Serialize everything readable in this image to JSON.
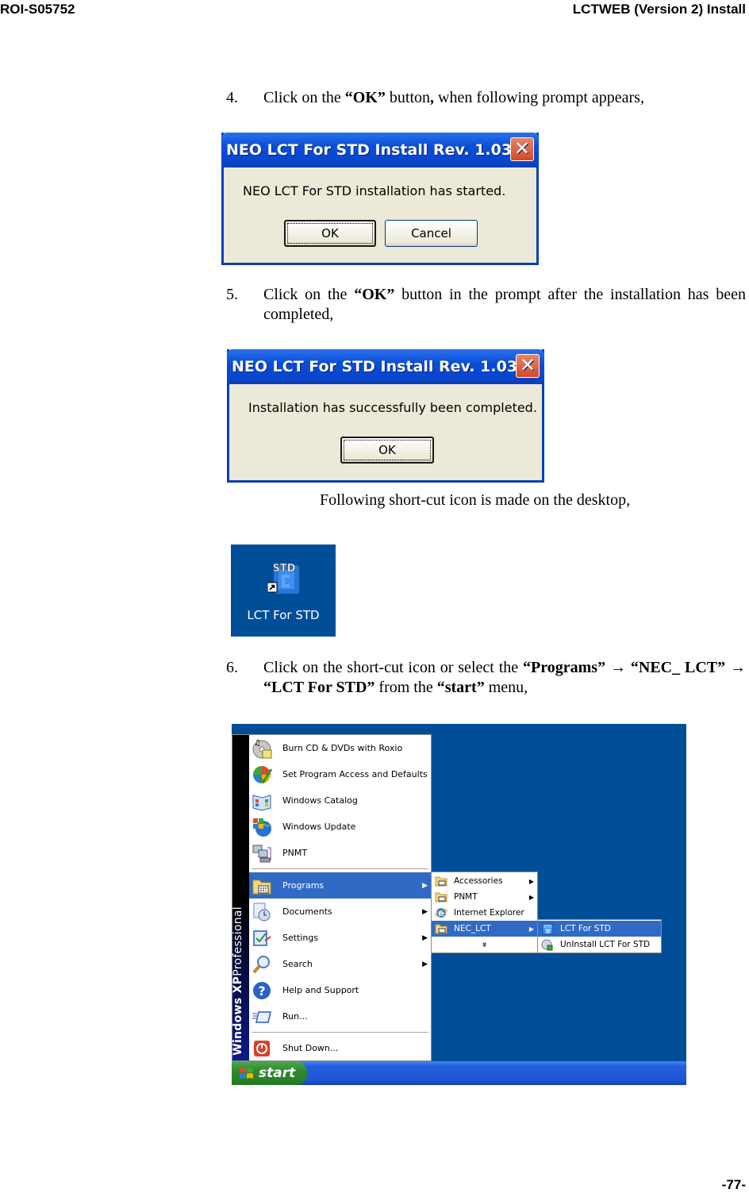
{
  "header": {
    "doc_id": "ROI-S05752",
    "title": "LCTWEB (Version 2) Install"
  },
  "footer": {
    "page": "-77-"
  },
  "steps": [
    {
      "num": "4.",
      "parts": [
        "Click on the ",
        "“OK”",
        " button",
        ",",
        " when following prompt appears,"
      ]
    },
    {
      "num": "5.",
      "parts": [
        "Click on the ",
        "“OK”",
        " button in the prompt after the installation has been completed,"
      ]
    },
    {
      "num": "6.",
      "parts": [
        "Click on the short-cut icon or select the ",
        "“Programs”",
        " → ",
        "“NEC_ LCT”",
        " → ",
        "“LCT For STD”",
        " from the ",
        "“start”",
        " menu,"
      ]
    }
  ],
  "caption_shortcut": "Following short-cut icon is made on the desktop,",
  "dialog1": {
    "title": "NEO LCT For STD Install  Rev. 1.03",
    "message": "NEO LCT For STD installation has started.",
    "ok": "OK",
    "cancel": "Cancel",
    "close_glyph": "✕"
  },
  "dialog2": {
    "title": "NEO LCT For STD Install  Rev. 1.03",
    "message": "Installation has successfully been completed.",
    "ok": "OK",
    "close_glyph": "✕"
  },
  "desktop_icon": {
    "label": "LCT For STD",
    "badge": "STD"
  },
  "start_menu": {
    "band_bold": "Windows XP",
    "band_light": "Professional",
    "top_items": [
      {
        "label": "Burn CD & DVDs with Roxio",
        "icon": "cd-icon"
      },
      {
        "label": "Set Program Access and Defaults",
        "icon": "program-access-icon"
      },
      {
        "label": "Windows Catalog",
        "icon": "catalog-icon"
      },
      {
        "label": "Windows Update",
        "icon": "windows-update-icon"
      },
      {
        "label": "PNMT",
        "icon": "network-computer-icon"
      }
    ],
    "main_items": [
      {
        "label": "Programs",
        "icon": "programs-folder-icon",
        "submenu": true,
        "selected": true
      },
      {
        "label": "Documents",
        "icon": "documents-icon",
        "submenu": true
      },
      {
        "label": "Settings",
        "icon": "settings-icon",
        "submenu": true
      },
      {
        "label": "Search",
        "icon": "search-icon",
        "submenu": true
      },
      {
        "label": "Help and Support",
        "icon": "help-icon"
      },
      {
        "label": "Run...",
        "icon": "run-icon"
      }
    ],
    "shutdown": "Shut Down...",
    "start_label": "start",
    "programs_submenu": [
      {
        "label": "Accessories",
        "submenu": true
      },
      {
        "label": "PNMT",
        "submenu": true
      },
      {
        "label": "Internet Explorer"
      },
      {
        "label": "NEC_LCT",
        "submenu": true,
        "selected": true
      },
      {
        "label": "»",
        "expand": true
      }
    ],
    "nec_submenu": [
      {
        "label": "LCT For STD",
        "selected": true
      },
      {
        "label": "UnInstall LCT For STD"
      }
    ]
  },
  "colors": {
    "xp_title_blue": "#0a4ed8",
    "xp_dialog_bg": "#ece9d8",
    "desktop_blue": "#004e98",
    "menu_highlight": "#316ac5",
    "start_green": "#2e8a2e",
    "taskbar_blue": "#245edb"
  }
}
